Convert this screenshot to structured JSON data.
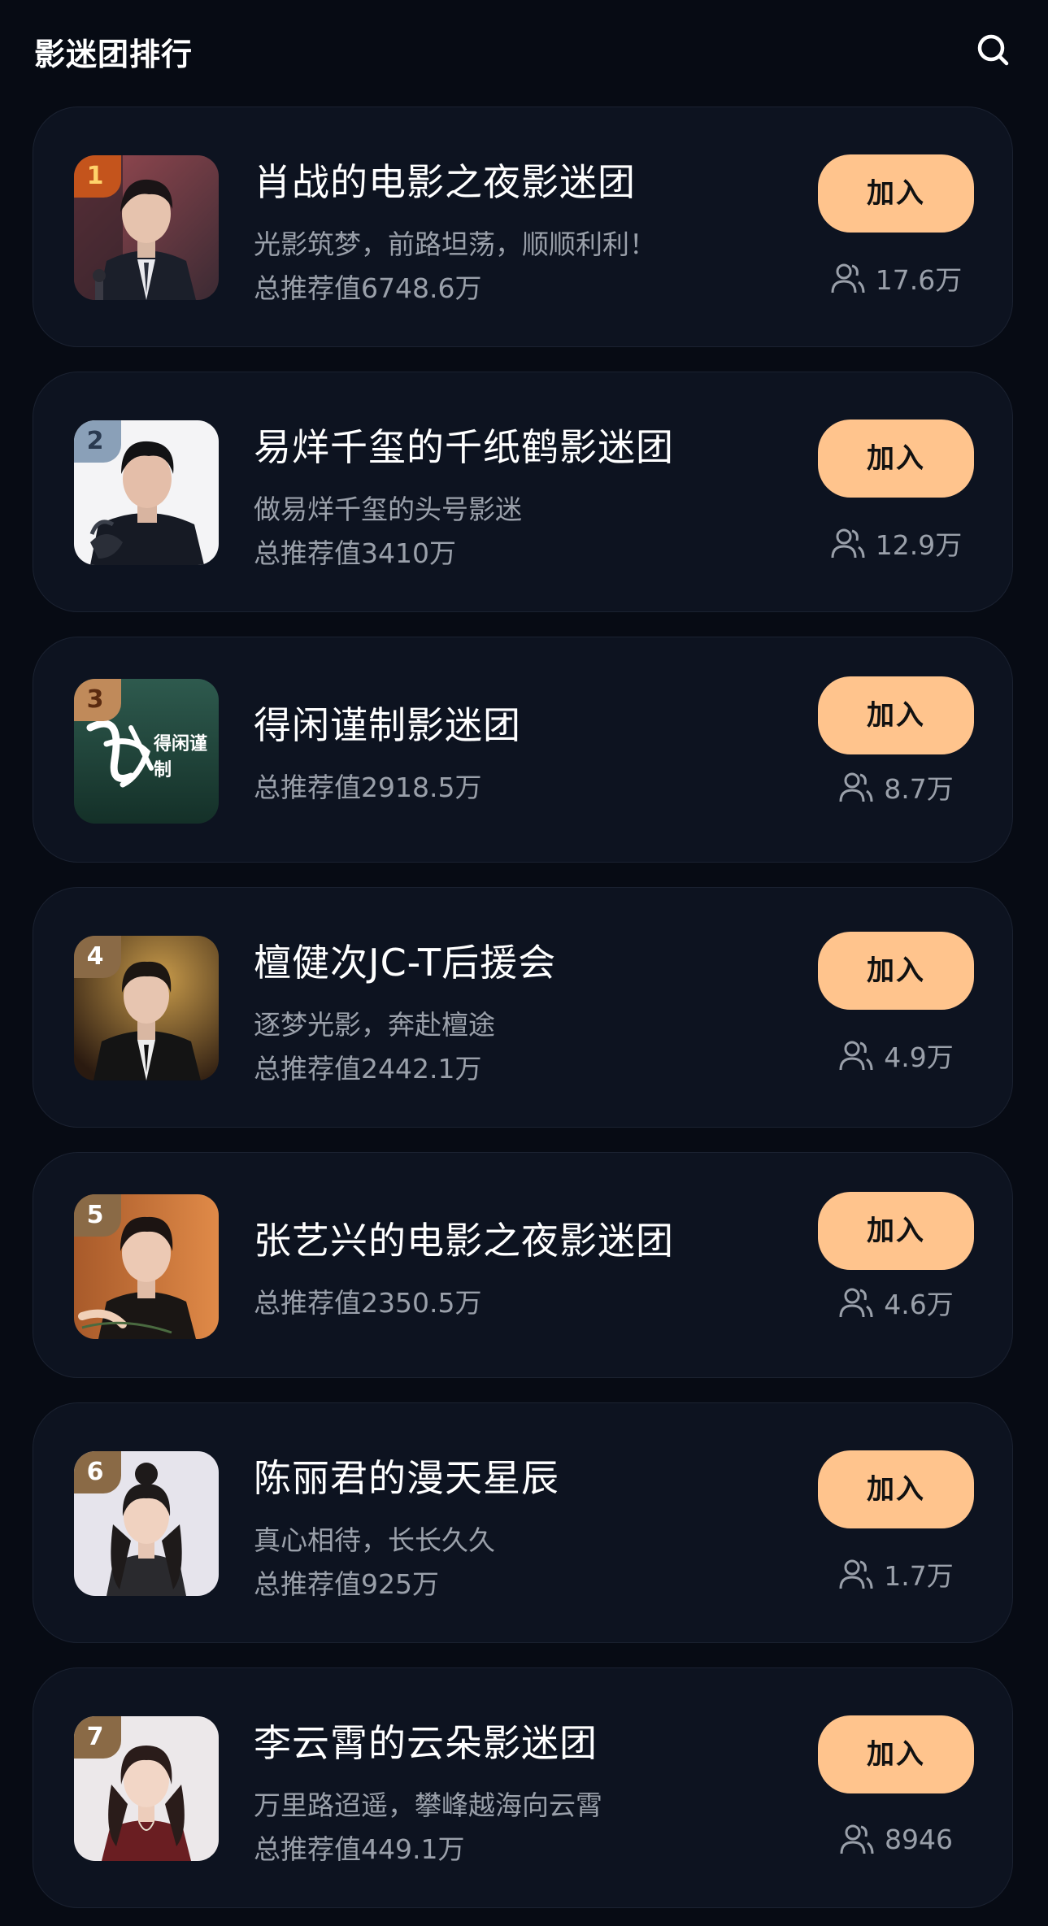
{
  "header": {
    "title": "影迷团排行",
    "search_icon": "search-icon"
  },
  "join_label": "加入",
  "colors": {
    "background": "#070b14",
    "card": "#0d1320",
    "accent_button": "#ffc48d",
    "muted_text": "#9aa0aa",
    "rank1": "#c4541c",
    "rank2": "#8aa0b8",
    "rank3": "#c08a5a",
    "rank_other": "#8a6a46"
  },
  "groups": [
    {
      "rank": "1",
      "name": "肖战的电影之夜影迷团",
      "slogan": "光影筑梦，前路坦荡，顺顺利利！",
      "score": "总推荐值6748.6万",
      "members": "17.6万"
    },
    {
      "rank": "2",
      "name": "易烊千玺的千纸鹤影迷团",
      "slogan": "做易烊千玺的头号影迷",
      "score": "总推荐值3410万",
      "members": "12.9万"
    },
    {
      "rank": "3",
      "name": "得闲谨制影迷团",
      "slogan": "",
      "score": "总推荐值2918.5万",
      "members": "8.7万"
    },
    {
      "rank": "4",
      "name": "檀健次JC-T后援会",
      "slogan": "逐梦光影，奔赴檀途",
      "score": "总推荐值2442.1万",
      "members": "4.9万"
    },
    {
      "rank": "5",
      "name": "张艺兴的电影之夜影迷团",
      "slogan": "",
      "score": "总推荐值2350.5万",
      "members": "4.6万"
    },
    {
      "rank": "6",
      "name": "陈丽君的漫天星辰",
      "slogan": "真心相待，长长久久",
      "score": "总推荐值925万",
      "members": "1.7万"
    },
    {
      "rank": "7",
      "name": "李云霄的云朵影迷团",
      "slogan": "万里路迢遥，攀峰越海向云霄",
      "score": "总推荐值449.1万",
      "members": "8946"
    }
  ],
  "thumb3_text": "得闲谨制"
}
